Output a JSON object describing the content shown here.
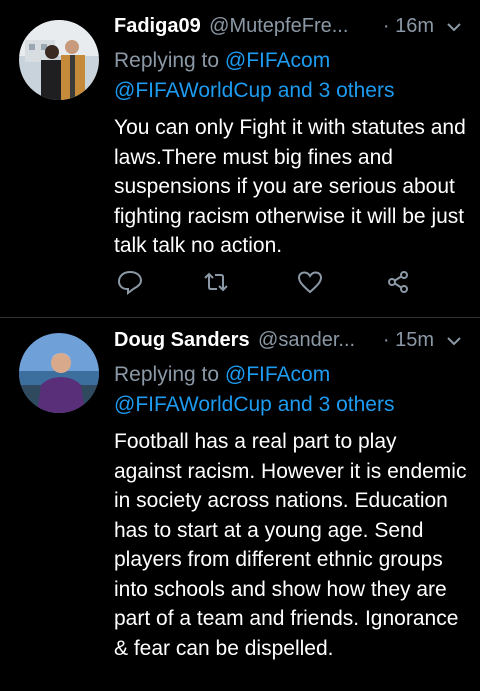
{
  "tweets": [
    {
      "name": "Fadiga09",
      "handle": "@MutepfeFre...",
      "time": "· 16m",
      "replying_prefix": "Replying to ",
      "replying_to_1": "@FIFAcom",
      "replying_to_2": "@FIFAWorldCup and 3 others",
      "text": "You can only Fight it with statutes and laws.There must big fines and suspensions if you are serious about  fighting racism otherwise it will be just talk talk no action.",
      "icons": [
        "reply-icon",
        "retweet-icon",
        "like-icon",
        "share-icon"
      ]
    },
    {
      "name": "Doug Sanders",
      "handle": "@sander...",
      "time": "· 15m",
      "replying_prefix": "Replying to ",
      "replying_to_1": "@FIFAcom",
      "replying_to_2": "@FIFAWorldCup and 3 others",
      "text": "Football has a real part to play against racism. However it is endemic in society across nations. Education has to start at a young age. Send players from different ethnic groups into schools and show how they are part of a team and friends. Ignorance & fear can be dispelled."
    }
  ],
  "colors": {
    "background": "#000000",
    "text": "#ffffff",
    "muted": "#8b98a5",
    "link": "#1d9bf0",
    "divider": "#2f3336"
  }
}
